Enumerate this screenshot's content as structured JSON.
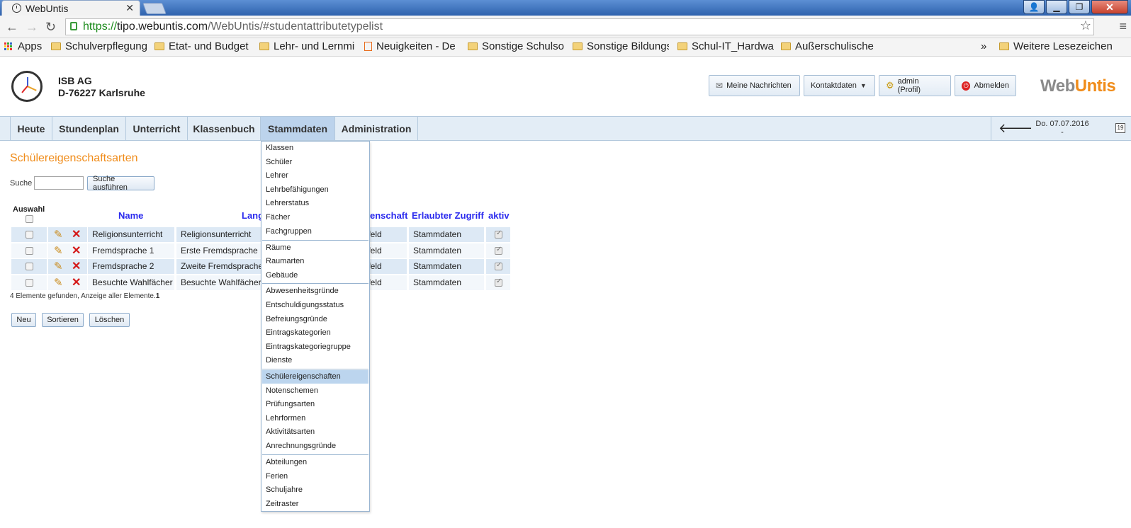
{
  "browser": {
    "tab_title": "WebUntis",
    "tab_close": "✕",
    "url_https": "https://",
    "url_host": "tipo.webuntis.com",
    "url_path": "/WebUntis/#studentattributetypelist",
    "bookmarks": [
      {
        "label": "Apps",
        "icon": "apps-icon"
      },
      {
        "label": "Schulverpflegung",
        "icon": "folder-icon"
      },
      {
        "label": "Etat- und Budget",
        "icon": "folder-icon"
      },
      {
        "label": "Lehr- und Lernmi",
        "icon": "folder-icon"
      },
      {
        "label": "Neuigkeiten - De",
        "icon": "page-icon"
      },
      {
        "label": "Sonstige Schulsof",
        "icon": "folder-icon"
      },
      {
        "label": "Sonstige Bildungs",
        "icon": "folder-icon"
      },
      {
        "label": "Schul-IT_Hardwar",
        "icon": "folder-icon"
      },
      {
        "label": "Außerschulische L",
        "icon": "folder-icon"
      }
    ],
    "more_bookmarks": "»",
    "other_bookmarks": "Weitere Lesezeichen"
  },
  "header": {
    "school_line1": "ISB AG",
    "school_line2": "D-76227 Karlsruhe",
    "messages": "Meine Nachrichten",
    "contact": "Kontaktdaten",
    "profile": "admin (Profil)",
    "logout": "Abmelden",
    "logo_web": "Web",
    "logo_untis": "Untis"
  },
  "nav": {
    "items": [
      "Heute",
      "Stundenplan",
      "Unterricht",
      "Klassenbuch",
      "Stammdaten",
      "Administration"
    ],
    "date": "Do. 07.07.2016",
    "date_sub": "-",
    "calendar_day": "19"
  },
  "page": {
    "title": "Schülereigenschaftsarten",
    "search_label": "Suche",
    "search_button": "Suche ausführen",
    "columns": {
      "select": "Auswahl",
      "name": "Name",
      "long": "Lang",
      "attr": "enschaft",
      "access": "Erlaubter Zugriff",
      "active": "aktiv"
    },
    "rows": [
      {
        "name": "Religionsunterricht",
        "long": "Religionsunterricht",
        "attr": "tfeld",
        "access": "Stammdaten"
      },
      {
        "name": "Fremdsprache 1",
        "long": "Erste Fremdsprache",
        "attr": "tfeld",
        "access": "Stammdaten"
      },
      {
        "name": "Fremdsprache 2",
        "long": "Zweite Fremdsprache",
        "attr": "tfeld",
        "access": "Stammdaten"
      },
      {
        "name": "Besuchte Wahlfächer",
        "long": "Besuchte Wahlfächer",
        "attr": "tfeld",
        "access": "Stammdaten"
      }
    ],
    "found_text": "4 Elemente gefunden, Anzeige aller Elemente.",
    "found_page": "1",
    "btn_new": "Neu",
    "btn_sort": "Sortieren",
    "btn_delete": "Löschen"
  },
  "dropdown": {
    "groups": [
      [
        "Klassen",
        "Schüler",
        "Lehrer",
        "Lehrbefähigungen",
        "Lehrerstatus",
        "Fächer",
        "Fachgruppen"
      ],
      [
        "Räume",
        "Raumarten",
        "Gebäude"
      ],
      [
        "Abwesenheitsgründe",
        "Entschuldigungsstatus",
        "Befreiungsgründe",
        "Eintragskategorien",
        "Eintragskategoriegruppe",
        "Dienste"
      ],
      [
        "Schülereigenschaften",
        "Notenschemen",
        "Prüfungsarten",
        "Lehrformen",
        "Aktivitätsarten",
        "Anrechnungsgründe"
      ],
      [
        "Abteilungen",
        "Ferien",
        "Schuljahre",
        "Zeitraster"
      ]
    ],
    "highlighted": "Schülereigenschaften"
  }
}
